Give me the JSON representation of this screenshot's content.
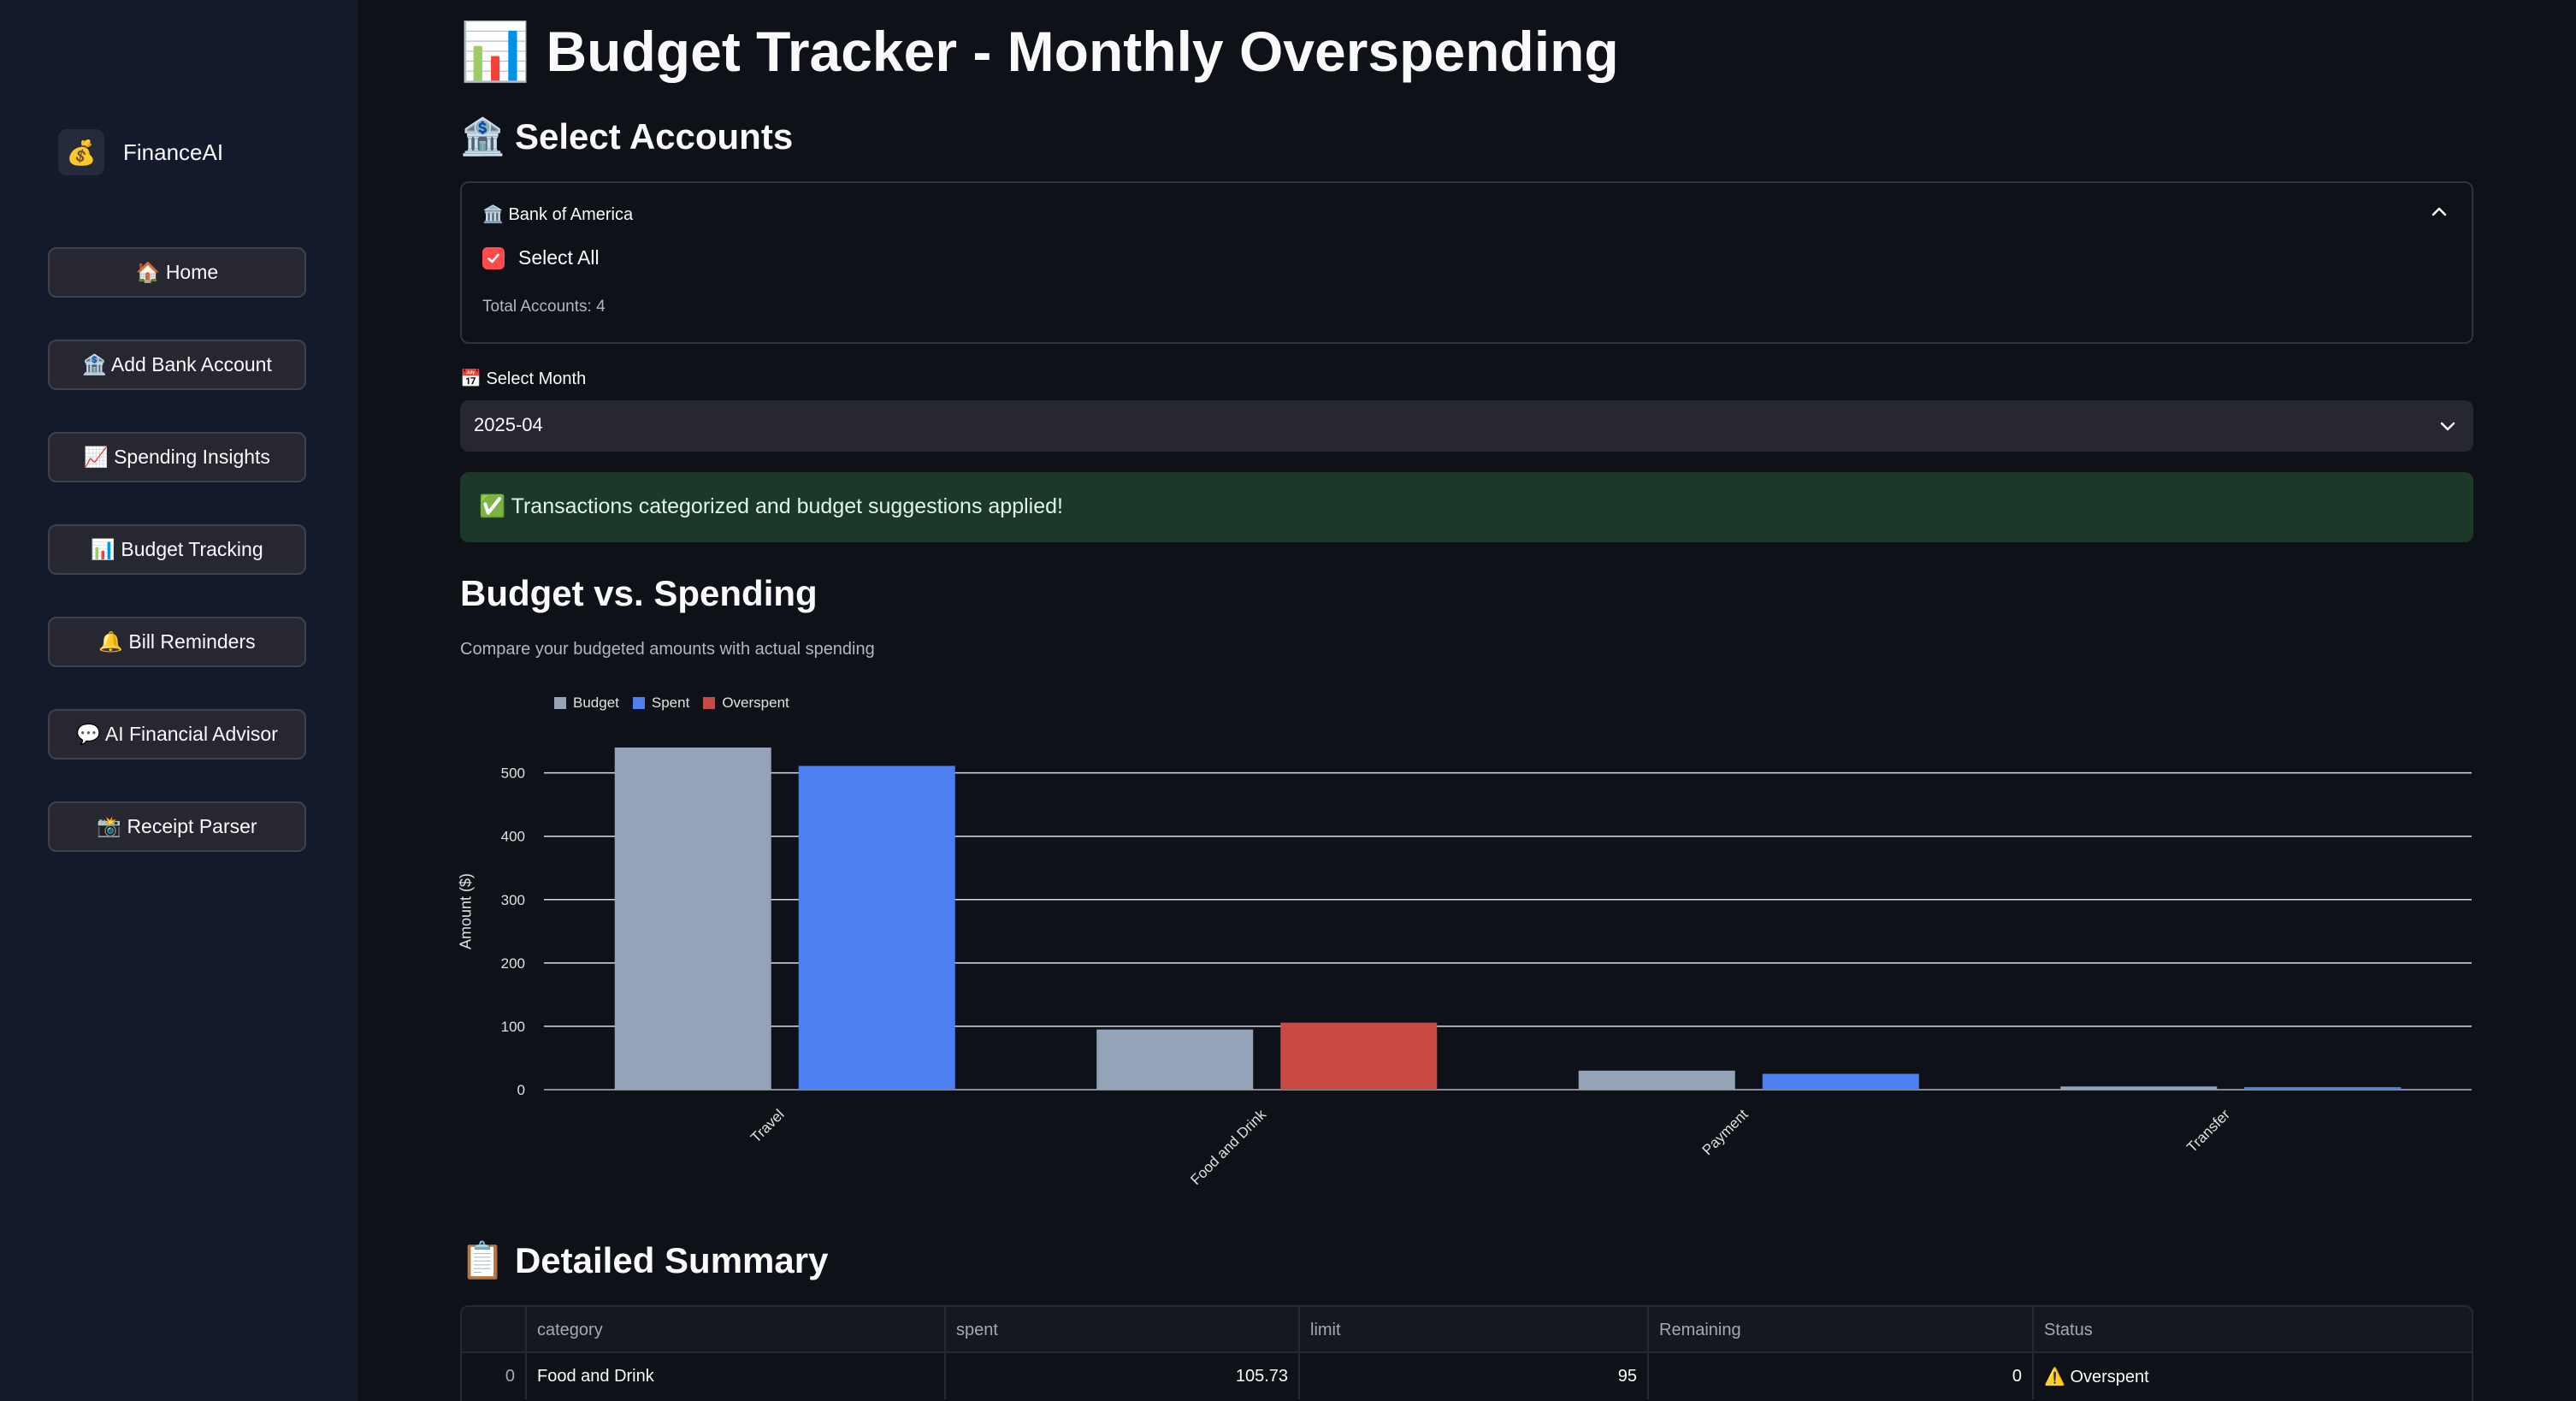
{
  "sidebar": {
    "brand": {
      "icon": "💰",
      "name": "FinanceAI"
    },
    "items": [
      {
        "label": "🏠 Home"
      },
      {
        "label": "🏦 Add Bank Account"
      },
      {
        "label": "📈 Spending Insights"
      },
      {
        "label": "📊 Budget Tracking"
      },
      {
        "label": "🔔 Bill Reminders"
      },
      {
        "label": "💬 AI Financial Advisor"
      },
      {
        "label": "📸 Receipt Parser"
      }
    ]
  },
  "page": {
    "title": "📊 Budget Tracker - Monthly Overspending",
    "accounts_heading": "🏦 Select Accounts",
    "bank": {
      "title": "🏛️ Bank of America",
      "select_all": "Select All",
      "total": "Total Accounts: 4"
    },
    "month": {
      "label": "📅 Select Month",
      "value": "2025-04"
    },
    "success": "✅ Transactions categorized and budget suggestions applied!",
    "chart_heading": "Budget vs. Spending",
    "chart_caption": "Compare your budgeted amounts with actual spending",
    "summary_heading": "📋 Detailed Summary"
  },
  "chart_data": {
    "type": "bar",
    "categories": [
      "Travel",
      "Food and Drink",
      "Payment",
      "Transfer"
    ],
    "series": [
      {
        "name": "Budget",
        "values": [
          540,
          95,
          30,
          5
        ],
        "color": "#94a3b8"
      },
      {
        "name": "Spent",
        "values": [
          511,
          105.73,
          25,
          4
        ],
        "colors": [
          "#4d7ff0",
          "#c94a45",
          "#4d7ff0",
          "#4d7ff0"
        ]
      }
    ],
    "legend": [
      {
        "name": "Budget",
        "color": "#94a3b8"
      },
      {
        "name": "Spent",
        "color": "#4d7ff0"
      },
      {
        "name": "Overspent",
        "color": "#c94a45"
      }
    ],
    "ylabel": "Amount ($)",
    "yticks": [
      0,
      100,
      200,
      300,
      400,
      500
    ],
    "ylim": [
      0,
      540
    ],
    "grid": true,
    "legend_position": "top-left"
  },
  "table": {
    "columns": [
      "",
      "category",
      "spent",
      "limit",
      "Remaining",
      "Status"
    ],
    "rows": [
      {
        "index": "0",
        "category": "Food and Drink",
        "spent": "105.73",
        "limit": "95",
        "remaining": "0",
        "status": "⚠️ Overspent"
      }
    ]
  }
}
